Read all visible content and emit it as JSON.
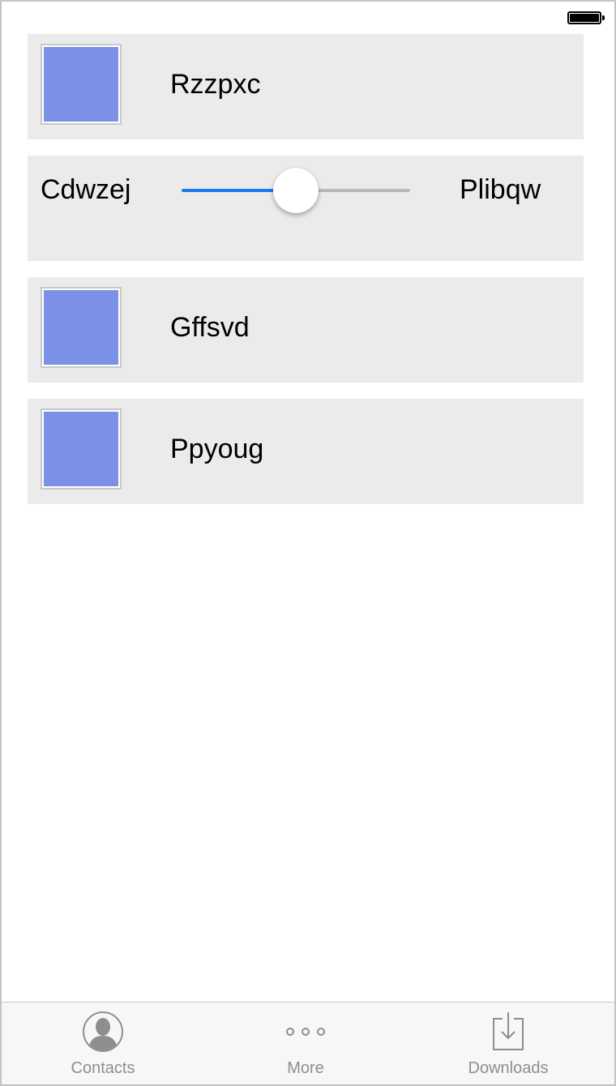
{
  "rows": [
    {
      "type": "image-label",
      "label": "Rzzpxc",
      "swatch_color": "#7a91e6"
    },
    {
      "type": "slider",
      "left_label": "Cdwzej",
      "right_label": "Plibqw",
      "value": 0.5
    },
    {
      "type": "image-label",
      "label": "Gffsvd",
      "swatch_color": "#7a91e6"
    },
    {
      "type": "image-label",
      "label": "Ppyoug",
      "swatch_color": "#7a91e6"
    }
  ],
  "tabbar": {
    "tabs": [
      {
        "label": "Contacts",
        "icon": "contacts-icon"
      },
      {
        "label": "More",
        "icon": "more-icon"
      },
      {
        "label": "Downloads",
        "icon": "downloads-icon"
      }
    ],
    "inactive_color": "#8e8e8e"
  },
  "colors": {
    "row_background": "#ebebeb",
    "slider_accent": "#1a7cf0",
    "slider_track": "#b8b8b8"
  }
}
